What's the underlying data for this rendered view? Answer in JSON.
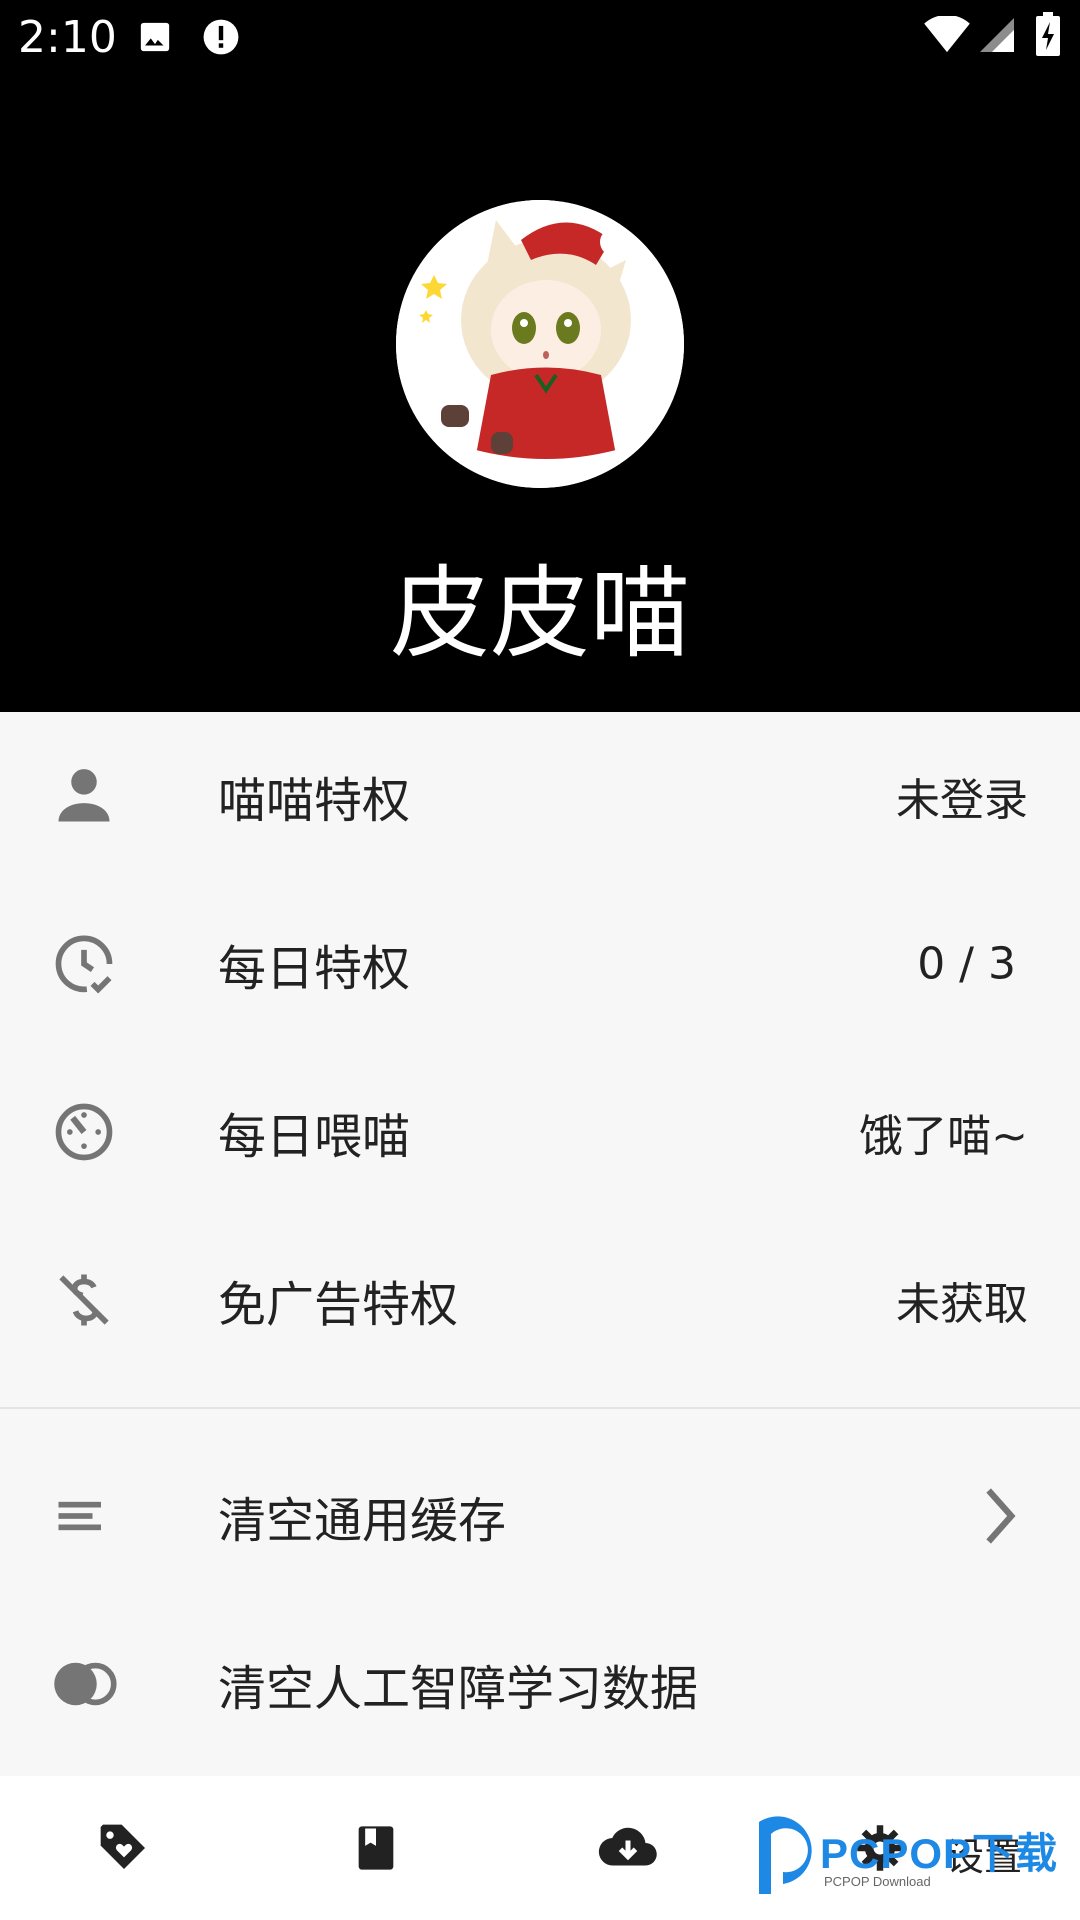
{
  "status_bar": {
    "time": "2:10",
    "icons": [
      "image-icon",
      "alert-icon",
      "wifi-icon",
      "signal-icon",
      "battery-charging-icon"
    ]
  },
  "header": {
    "avatar_icon": "anime-cat-girl-avatar",
    "username": "皮皮喵"
  },
  "menu": {
    "items": [
      {
        "icon": "person-icon",
        "label": "喵喵特权",
        "value": "未登录"
      },
      {
        "icon": "clock-check-icon",
        "label": "每日特权",
        "value": "0 / 3"
      },
      {
        "icon": "timer-icon",
        "label": "每日喂喵",
        "value": "饿了喵~"
      },
      {
        "icon": "no-money-icon",
        "label": "免广告特权",
        "value": "未获取"
      }
    ],
    "actions": [
      {
        "icon": "lines-icon",
        "label": "清空通用缓存",
        "trailing": "chevron-right-icon"
      },
      {
        "icon": "toggle-circles-icon",
        "label": "清空人工智障学习数据"
      }
    ]
  },
  "bottom_nav": {
    "items": [
      {
        "icon": "tag-heart-icon"
      },
      {
        "icon": "book-icon"
      },
      {
        "icon": "cloud-download-icon"
      },
      {
        "icon": "gear-icon",
        "label": "设置"
      }
    ]
  },
  "watermark": {
    "brand": "PCPOP下载",
    "sub": "PCPOP Download"
  }
}
